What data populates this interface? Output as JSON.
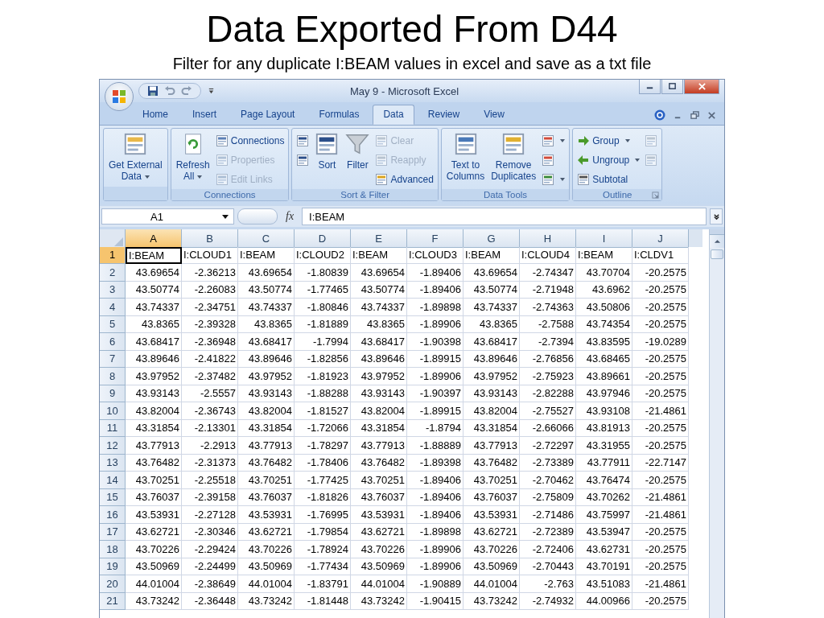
{
  "slide": {
    "title": "Data Exported From D44",
    "subtitle": "Filter for any duplicate I:BEAM values in excel and save as a txt file"
  },
  "window": {
    "title": "May 9 - Microsoft Excel"
  },
  "tabs": [
    {
      "label": "Home",
      "selected": false
    },
    {
      "label": "Insert",
      "selected": false
    },
    {
      "label": "Page Layout",
      "selected": false
    },
    {
      "label": "Formulas",
      "selected": false
    },
    {
      "label": "Data",
      "selected": true
    },
    {
      "label": "Review",
      "selected": false
    },
    {
      "label": "View",
      "selected": false
    }
  ],
  "ribbon": {
    "groups": [
      {
        "launcher": false,
        "buttons": [
          {
            "kind": "large",
            "label": "Get External\nData",
            "dropdown": true,
            "disabled": false
          }
        ]
      },
      {
        "label": "Connections",
        "launcher": false,
        "buttons": [
          {
            "kind": "large",
            "label": "Refresh\nAll",
            "dropdown": true,
            "disabled": false
          },
          {
            "kind": "small",
            "label": "Connections",
            "dropdown": false,
            "disabled": false
          },
          {
            "kind": "small",
            "label": "Properties",
            "dropdown": false,
            "disabled": true
          },
          {
            "kind": "small",
            "label": "Edit Links",
            "dropdown": false,
            "disabled": true
          }
        ]
      },
      {
        "label": "Sort & Filter",
        "launcher": false,
        "buttons": [
          {
            "kind": "icon",
            "dropdown": false,
            "disabled": false
          },
          {
            "kind": "icon",
            "dropdown": false,
            "disabled": false
          },
          {
            "kind": "large",
            "label": "Sort",
            "dropdown": false,
            "disabled": false
          },
          {
            "kind": "large",
            "label": "Filter",
            "dropdown": false,
            "disabled": false
          },
          {
            "kind": "small",
            "label": "Clear",
            "dropdown": false,
            "disabled": true
          },
          {
            "kind": "small",
            "label": "Reapply",
            "dropdown": false,
            "disabled": true
          },
          {
            "kind": "small",
            "label": "Advanced",
            "dropdown": false,
            "disabled": false
          }
        ]
      },
      {
        "label": "Data Tools",
        "launcher": false,
        "buttons": [
          {
            "kind": "large",
            "label": "Text to\nColumns",
            "dropdown": false,
            "disabled": false
          },
          {
            "kind": "large",
            "label": "Remove\nDuplicates",
            "dropdown": false,
            "disabled": false
          },
          {
            "kind": "icon",
            "dropdown": true,
            "disabled": false
          },
          {
            "kind": "icon",
            "dropdown": false,
            "disabled": false
          },
          {
            "kind": "icon",
            "dropdown": true,
            "disabled": false
          }
        ]
      },
      {
        "label": "Outline",
        "launcher": true,
        "buttons": [
          {
            "kind": "small",
            "label": "Group",
            "dropdown": true,
            "disabled": false
          },
          {
            "kind": "small",
            "label": "Ungroup",
            "dropdown": true,
            "disabled": false
          },
          {
            "kind": "small",
            "label": "Subtotal",
            "dropdown": false,
            "disabled": false
          },
          {
            "kind": "icon",
            "dropdown": false,
            "disabled": true
          },
          {
            "kind": "icon",
            "dropdown": false,
            "disabled": true
          }
        ]
      }
    ]
  },
  "formula_bar": {
    "name_box": "A1",
    "function_label": "fx",
    "value": "I:BEAM"
  },
  "sheet": {
    "columns": [
      {
        "label": "A",
        "selected": true
      },
      {
        "label": "B",
        "selected": false
      },
      {
        "label": "C",
        "selected": false
      },
      {
        "label": "D",
        "selected": false
      },
      {
        "label": "E",
        "selected": false
      },
      {
        "label": "F",
        "selected": false
      },
      {
        "label": "G",
        "selected": false
      },
      {
        "label": "H",
        "selected": false
      },
      {
        "label": "I",
        "selected": false
      },
      {
        "label": "J",
        "selected": false
      }
    ],
    "rows": [
      {
        "number": "1",
        "selected": true,
        "kind": "header",
        "cells": [
          "I:BEAM",
          "I:CLOUD1",
          "I:BEAM",
          "I:CLOUD2",
          "I:BEAM",
          "I:CLOUD3",
          "I:BEAM",
          "I:CLOUD4",
          "I:BEAM",
          "I:CLDV1"
        ]
      },
      {
        "number": "2",
        "selected": false,
        "kind": "number",
        "cells": [
          "43.69654",
          "-2.36213",
          "43.69654",
          "-1.80839",
          "43.69654",
          "-1.89406",
          "43.69654",
          "-2.74347",
          "43.70704",
          "-20.2575"
        ]
      },
      {
        "number": "3",
        "selected": false,
        "kind": "number",
        "cells": [
          "43.50774",
          "-2.26083",
          "43.50774",
          "-1.77465",
          "43.50774",
          "-1.89406",
          "43.50774",
          "-2.71948",
          "43.6962",
          "-20.2575"
        ]
      },
      {
        "number": "4",
        "selected": false,
        "kind": "number",
        "cells": [
          "43.74337",
          "-2.34751",
          "43.74337",
          "-1.80846",
          "43.74337",
          "-1.89898",
          "43.74337",
          "-2.74363",
          "43.50806",
          "-20.2575"
        ]
      },
      {
        "number": "5",
        "selected": false,
        "kind": "number",
        "cells": [
          "43.8365",
          "-2.39328",
          "43.8365",
          "-1.81889",
          "43.8365",
          "-1.89906",
          "43.8365",
          "-2.7588",
          "43.74354",
          "-20.2575"
        ]
      },
      {
        "number": "6",
        "selected": false,
        "kind": "number",
        "cells": [
          "43.68417",
          "-2.36948",
          "43.68417",
          "-1.7994",
          "43.68417",
          "-1.90398",
          "43.68417",
          "-2.7394",
          "43.83595",
          "-19.0289"
        ]
      },
      {
        "number": "7",
        "selected": false,
        "kind": "number",
        "cells": [
          "43.89646",
          "-2.41822",
          "43.89646",
          "-1.82856",
          "43.89646",
          "-1.89915",
          "43.89646",
          "-2.76856",
          "43.68465",
          "-20.2575"
        ]
      },
      {
        "number": "8",
        "selected": false,
        "kind": "number",
        "cells": [
          "43.97952",
          "-2.37482",
          "43.97952",
          "-1.81923",
          "43.97952",
          "-1.89906",
          "43.97952",
          "-2.75923",
          "43.89661",
          "-20.2575"
        ]
      },
      {
        "number": "9",
        "selected": false,
        "kind": "number",
        "cells": [
          "43.93143",
          "-2.5557",
          "43.93143",
          "-1.88288",
          "43.93143",
          "-1.90397",
          "43.93143",
          "-2.82288",
          "43.97946",
          "-20.2575"
        ]
      },
      {
        "number": "10",
        "selected": false,
        "kind": "number",
        "cells": [
          "43.82004",
          "-2.36743",
          "43.82004",
          "-1.81527",
          "43.82004",
          "-1.89915",
          "43.82004",
          "-2.75527",
          "43.93108",
          "-21.4861"
        ]
      },
      {
        "number": "11",
        "selected": false,
        "kind": "number",
        "cells": [
          "43.31854",
          "-2.13301",
          "43.31854",
          "-1.72066",
          "43.31854",
          "-1.8794",
          "43.31854",
          "-2.66066",
          "43.81913",
          "-20.2575"
        ]
      },
      {
        "number": "12",
        "selected": false,
        "kind": "number",
        "cells": [
          "43.77913",
          "-2.2913",
          "43.77913",
          "-1.78297",
          "43.77913",
          "-1.88889",
          "43.77913",
          "-2.72297",
          "43.31955",
          "-20.2575"
        ]
      },
      {
        "number": "13",
        "selected": false,
        "kind": "number",
        "cells": [
          "43.76482",
          "-2.31373",
          "43.76482",
          "-1.78406",
          "43.76482",
          "-1.89398",
          "43.76482",
          "-2.73389",
          "43.77911",
          "-22.7147"
        ]
      },
      {
        "number": "14",
        "selected": false,
        "kind": "number",
        "cells": [
          "43.70251",
          "-2.25518",
          "43.70251",
          "-1.77425",
          "43.70251",
          "-1.89406",
          "43.70251",
          "-2.70462",
          "43.76474",
          "-20.2575"
        ]
      },
      {
        "number": "15",
        "selected": false,
        "kind": "number",
        "cells": [
          "43.76037",
          "-2.39158",
          "43.76037",
          "-1.81826",
          "43.76037",
          "-1.89406",
          "43.76037",
          "-2.75809",
          "43.70262",
          "-21.4861"
        ]
      },
      {
        "number": "16",
        "selected": false,
        "kind": "number",
        "cells": [
          "43.53931",
          "-2.27128",
          "43.53931",
          "-1.76995",
          "43.53931",
          "-1.89406",
          "43.53931",
          "-2.71486",
          "43.75997",
          "-21.4861"
        ]
      },
      {
        "number": "17",
        "selected": false,
        "kind": "number",
        "cells": [
          "43.62721",
          "-2.30346",
          "43.62721",
          "-1.79854",
          "43.62721",
          "-1.89898",
          "43.62721",
          "-2.72389",
          "43.53947",
          "-20.2575"
        ]
      },
      {
        "number": "18",
        "selected": false,
        "kind": "number",
        "cells": [
          "43.70226",
          "-2.29424",
          "43.70226",
          "-1.78924",
          "43.70226",
          "-1.89906",
          "43.70226",
          "-2.72406",
          "43.62731",
          "-20.2575"
        ]
      },
      {
        "number": "19",
        "selected": false,
        "kind": "number",
        "cells": [
          "43.50969",
          "-2.24499",
          "43.50969",
          "-1.77434",
          "43.50969",
          "-1.89906",
          "43.50969",
          "-2.70443",
          "43.70191",
          "-20.2575"
        ]
      },
      {
        "number": "20",
        "selected": false,
        "kind": "number",
        "cells": [
          "44.01004",
          "-2.38649",
          "44.01004",
          "-1.83791",
          "44.01004",
          "-1.90889",
          "44.01004",
          "-2.763",
          "43.51083",
          "-21.4861"
        ]
      },
      {
        "number": "21",
        "selected": false,
        "kind": "number",
        "cells": [
          "43.73242",
          "-2.36448",
          "43.73242",
          "-1.81448",
          "43.73242",
          "-1.90415",
          "43.73242",
          "-2.74932",
          "44.00966",
          "-20.2575"
        ]
      }
    ]
  }
}
